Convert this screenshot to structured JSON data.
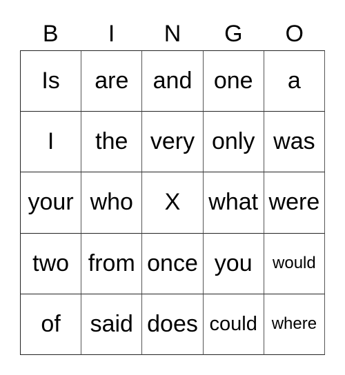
{
  "header": [
    "B",
    "I",
    "N",
    "G",
    "O"
  ],
  "cells": [
    [
      "Is",
      "are",
      "and",
      "one",
      "a"
    ],
    [
      "I",
      "the",
      "very",
      "only",
      "was"
    ],
    [
      "your",
      "who",
      "X",
      "what",
      "were"
    ],
    [
      "two",
      "from",
      "once",
      "you",
      "would"
    ],
    [
      "of",
      "said",
      "does",
      "could",
      "where"
    ]
  ]
}
